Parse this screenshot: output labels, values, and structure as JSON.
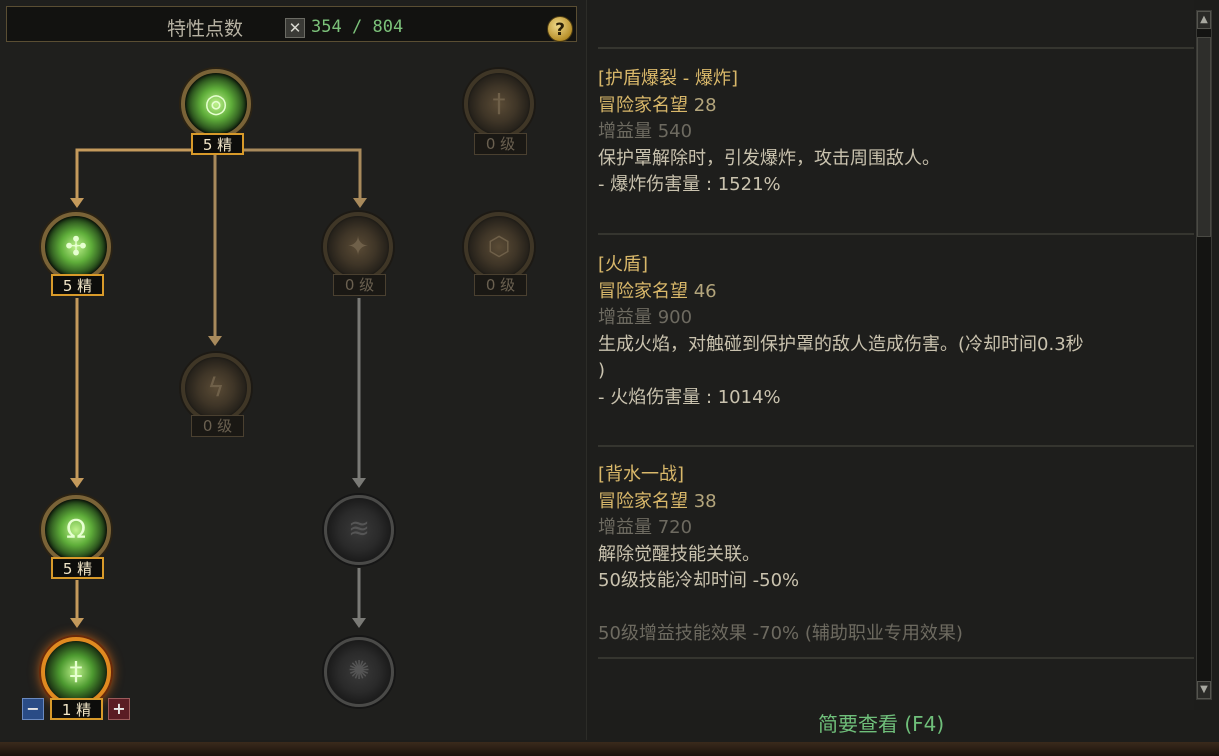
{
  "header": {
    "title": "特性点数",
    "points_used": "354",
    "points_sep": "/",
    "points_total": "804",
    "help": "?"
  },
  "tree": {
    "nodes": [
      {
        "id": "n1",
        "level": "5 精",
        "state": "active",
        "icon": "swirl-icon"
      },
      {
        "id": "n2",
        "level": "0 级",
        "state": "inactive",
        "icon": "sword-icon"
      },
      {
        "id": "n3",
        "level": "5 精",
        "state": "active",
        "icon": "shield-burst-icon"
      },
      {
        "id": "n4",
        "level": "0 级",
        "state": "inactive",
        "icon": "flame-icon"
      },
      {
        "id": "n5",
        "level": "0 级",
        "state": "inactive",
        "icon": "hex-shield-icon"
      },
      {
        "id": "n6",
        "level": "0 级",
        "state": "inactive",
        "icon": "lightning-icon"
      },
      {
        "id": "n7",
        "level": "5 精",
        "state": "active",
        "icon": "ring-icon"
      },
      {
        "id": "n8",
        "level": "",
        "state": "locked",
        "icon": "wave-icon"
      },
      {
        "id": "n9",
        "level": "1 精",
        "state": "selected",
        "icon": "blade-icon"
      },
      {
        "id": "n10",
        "level": "",
        "state": "locked",
        "icon": "vortex-icon"
      }
    ],
    "minus": "−",
    "plus": "+"
  },
  "details": [
    {
      "name": "[护盾爆裂 - 爆炸]",
      "rep_label": "冒险家名望",
      "rep_value": "28",
      "gain": "增益量 540",
      "desc": "保护罩解除时，引发爆炸，攻击周围敌人。",
      "effect": "- 爆炸伤害量 : 1521%"
    },
    {
      "name": "[火盾]",
      "rep_label": "冒险家名望",
      "rep_value": "46",
      "gain": "增益量 900",
      "desc": "生成火焰，对触碰到保护罩的敌人造成伤害。(冷却时间0.3秒",
      "desc2": ")",
      "effect": "- 火焰伤害量 : 1014%"
    },
    {
      "name": "[背水一战]",
      "rep_label": "冒险家名望",
      "rep_value": "38",
      "gain": "增益量 720",
      "desc": "解除觉醒技能关联。",
      "effect": "50级技能冷却时间 -50%",
      "muted": "50级增益技能效果 -70% (辅助职业专用效果)"
    }
  ],
  "footer": "简要查看 (F4)",
  "colors": {
    "gold": "#d9b86a",
    "green": "#7cc27a",
    "accent_orange": "#e08a20"
  }
}
